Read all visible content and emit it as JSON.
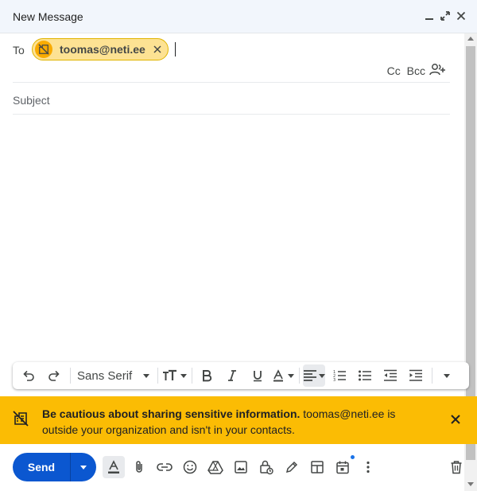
{
  "window": {
    "title": "New Message"
  },
  "recipients": {
    "to_label": "To",
    "chips": [
      {
        "email": "toomas@neti.ee"
      }
    ],
    "cc_label": "Cc",
    "bcc_label": "Bcc"
  },
  "subject": {
    "placeholder": "Subject",
    "value": ""
  },
  "format_bar": {
    "font_name": "Sans Serif"
  },
  "warning": {
    "bold_text": "Be cautious about sharing sensitive information.",
    "rest_text": " toomas@neti.ee is outside your organization and isn't in your contacts."
  },
  "footer": {
    "send_label": "Send"
  },
  "colors": {
    "accent": "#0b57d0",
    "warning": "#fbbc04",
    "chip_bg": "#fde293"
  }
}
